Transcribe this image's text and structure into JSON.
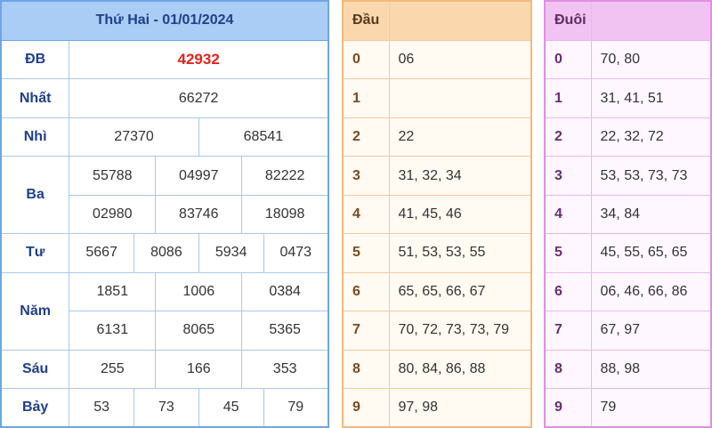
{
  "results": {
    "title": "Thứ Hai - 01/01/2024",
    "rows": [
      {
        "label": "ĐB",
        "numbers": [
          "42932"
        ]
      },
      {
        "label": "Nhất",
        "numbers": [
          "66272"
        ]
      },
      {
        "label": "Nhì",
        "numbers": [
          "27370",
          "68541"
        ]
      },
      {
        "label": "Ba",
        "numbers": [
          "55788",
          "04997",
          "82222",
          "02980",
          "83746",
          "18098"
        ]
      },
      {
        "label": "Tư",
        "numbers": [
          "5667",
          "8086",
          "5934",
          "0473"
        ]
      },
      {
        "label": "Năm",
        "numbers": [
          "1851",
          "1006",
          "0384",
          "6131",
          "8065",
          "5365"
        ]
      },
      {
        "label": "Sáu",
        "numbers": [
          "255",
          "166",
          "353"
        ]
      },
      {
        "label": "Bảy",
        "numbers": [
          "53",
          "73",
          "45",
          "79"
        ]
      }
    ]
  },
  "dau": {
    "header": "Đầu",
    "rows": [
      {
        "digit": "0",
        "values": "06"
      },
      {
        "digit": "1",
        "values": ""
      },
      {
        "digit": "2",
        "values": "22"
      },
      {
        "digit": "3",
        "values": "31, 32, 34"
      },
      {
        "digit": "4",
        "values": "41, 45, 46"
      },
      {
        "digit": "5",
        "values": "51, 53, 53, 55"
      },
      {
        "digit": "6",
        "values": "65, 65, 66, 67"
      },
      {
        "digit": "7",
        "values": "70, 72, 73, 73, 79"
      },
      {
        "digit": "8",
        "values": "80, 84, 86, 88"
      },
      {
        "digit": "9",
        "values": "97, 98"
      }
    ]
  },
  "duoi": {
    "header": "Đuôi",
    "rows": [
      {
        "digit": "0",
        "values": "70, 80"
      },
      {
        "digit": "1",
        "values": "31, 41, 51"
      },
      {
        "digit": "2",
        "values": "22, 32, 72"
      },
      {
        "digit": "3",
        "values": "53, 53, 73, 73"
      },
      {
        "digit": "4",
        "values": "34, 84"
      },
      {
        "digit": "5",
        "values": "45, 55, 65, 65"
      },
      {
        "digit": "6",
        "values": "06, 46, 66, 86"
      },
      {
        "digit": "7",
        "values": "67, 97"
      },
      {
        "digit": "8",
        "values": "88, 98"
      },
      {
        "digit": "9",
        "values": "79"
      }
    ]
  },
  "colors": {
    "special_prize": "#e2221b",
    "results_header": "#a9cdf5",
    "dau_header": "#fbd7ae",
    "duoi_header": "#f0c3f2"
  }
}
